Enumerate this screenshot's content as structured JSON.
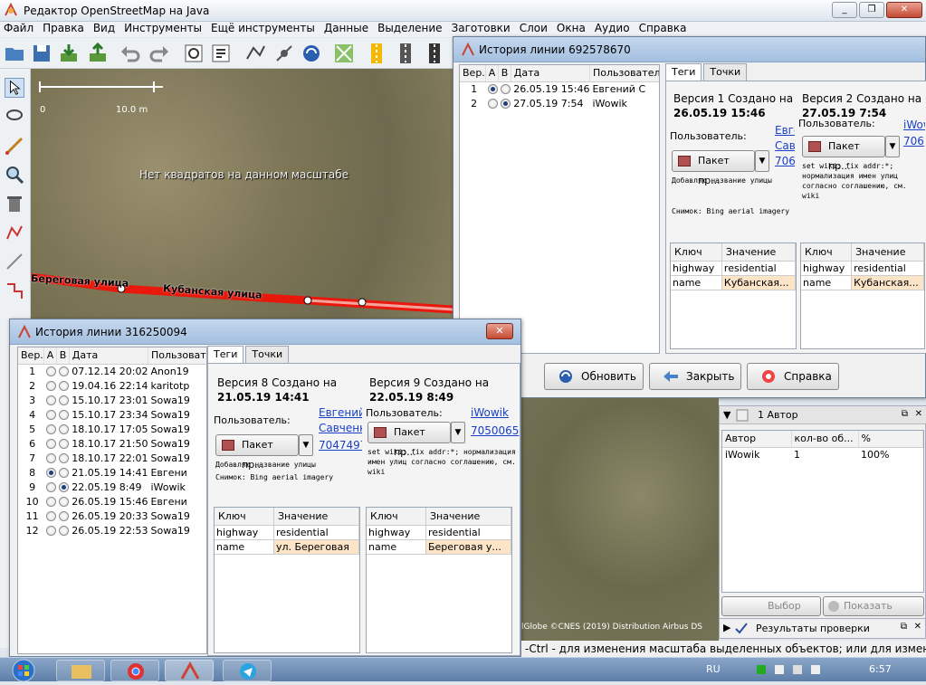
{
  "app": {
    "title": "Редактор OpenStreetMap на Java"
  },
  "menu": [
    "Файл",
    "Правка",
    "Вид",
    "Инструменты",
    "Ещё инструменты",
    "Данные",
    "Выделение",
    "Заготовки",
    "Слои",
    "Окна",
    "Аудио",
    "Справка"
  ],
  "map": {
    "message": "Нет квадратов на данном масштабе",
    "scale_start": "0",
    "scale_end": "10.0 m",
    "road_label_1": "Береговая улица",
    "road_label_2": "Кубанская улица",
    "attribution": "lGlobe ©CNES (2019) Distribution Airbus DS",
    "road_color": "#e8180c"
  },
  "dialog1": {
    "title": "История линии 692578670",
    "columns": [
      "Вер.",
      "A",
      "B",
      "Дата",
      "Пользователь"
    ],
    "rows": [
      {
        "ver": "1",
        "a": true,
        "b": false,
        "date": "26.05.19 15:46",
        "user": "Евгений С"
      },
      {
        "ver": "2",
        "a": false,
        "b": true,
        "date": "27.05.19 7:54",
        "user": "iWowik"
      }
    ],
    "tabs": [
      "Теги",
      "Точки"
    ],
    "left": {
      "version_line": "Версия 1 Создано на",
      "date": "26.05.19 15:46",
      "user_label": "Пользователь:",
      "user_link": "Евгений Савченко",
      "changeset_link": "706",
      "pkt": "Пакет пр...",
      "comment": "Добавляю название улицы",
      "source": "Снимок: Bing aerial imagery"
    },
    "right": {
      "version_line": "Версия 2 Создано на",
      "date": "27.05.19 7:54",
      "user_label": "Пользователь:",
      "user_link": "iWowik",
      "changeset_link": "706",
      "pkt": "Пакет пр...",
      "comment": "set wiki; fix addr:*; нормализация имен улиц согласно соглашению, см. wiki"
    },
    "kv_headers": [
      "Ключ",
      "Значение"
    ],
    "kv_left": [
      [
        "highway",
        "residential"
      ],
      [
        "name",
        "Кубанская..."
      ]
    ],
    "kv_right": [
      [
        "highway",
        "residential"
      ],
      [
        "name",
        "Кубанская..."
      ]
    ],
    "buttons": {
      "refresh": "Обновить",
      "close": "Закрыть",
      "help": "Справка"
    }
  },
  "dialog2": {
    "title": "История линии 316250094",
    "columns": [
      "Вер.",
      "A",
      "B",
      "Дата",
      "Пользователь"
    ],
    "rows": [
      {
        "ver": "1",
        "a": false,
        "b": false,
        "date": "07.12.14 20:02",
        "user": "Anon19"
      },
      {
        "ver": "2",
        "a": false,
        "b": false,
        "date": "19.04.16 22:14",
        "user": "karitotp"
      },
      {
        "ver": "3",
        "a": false,
        "b": false,
        "date": "15.10.17 23:01",
        "user": "Sowa19"
      },
      {
        "ver": "4",
        "a": false,
        "b": false,
        "date": "15.10.17 23:34",
        "user": "Sowa19"
      },
      {
        "ver": "5",
        "a": false,
        "b": false,
        "date": "18.10.17 17:05",
        "user": "Sowa19"
      },
      {
        "ver": "6",
        "a": false,
        "b": false,
        "date": "18.10.17 21:50",
        "user": "Sowa19"
      },
      {
        "ver": "7",
        "a": false,
        "b": false,
        "date": "18.10.17 22:01",
        "user": "Sowa19"
      },
      {
        "ver": "8",
        "a": true,
        "b": false,
        "date": "21.05.19 14:41",
        "user": "Евгени"
      },
      {
        "ver": "9",
        "a": false,
        "b": true,
        "date": "22.05.19 8:49",
        "user": "iWowik"
      },
      {
        "ver": "10",
        "a": false,
        "b": false,
        "date": "26.05.19 15:46",
        "user": "Евгени"
      },
      {
        "ver": "11",
        "a": false,
        "b": false,
        "date": "26.05.19 20:33",
        "user": "Sowa19"
      },
      {
        "ver": "12",
        "a": false,
        "b": false,
        "date": "26.05.19 22:53",
        "user": "Sowa19"
      }
    ],
    "tabs": [
      "Теги",
      "Точки"
    ],
    "left": {
      "version_line": "Версия 8 Создано на",
      "date": "21.05.19 14:41",
      "user_label": "Пользователь:",
      "user_link": "Евгений Савченко",
      "changeset_link": "7047497",
      "pkt": "Пакет пр...",
      "comment": "Добавляю название улицы",
      "source": "Снимок: Bing aerial imagery"
    },
    "right": {
      "version_line": "Версия 9 Создано на",
      "date": "22.05.19 8:49",
      "user_label": "Пользователь:",
      "user_link": "iWowik",
      "changeset_link": "7050065",
      "pkt": "Пакет пр...",
      "comment": "set wiki; fix addr:*; нормализация имен улиц согласно соглашению, см. wiki"
    },
    "kv_headers": [
      "Ключ",
      "Значение"
    ],
    "kv_left": [
      [
        "highway",
        "residential"
      ],
      [
        "name",
        "ул. Береговая"
      ]
    ],
    "kv_right": [
      [
        "highway",
        "residential"
      ],
      [
        "name",
        "Береговая у..."
      ]
    ]
  },
  "authors": {
    "title": "1 Автор",
    "columns": [
      "Автор",
      "кол-во об...",
      "%"
    ],
    "rows": [
      [
        "iWowik",
        "1",
        "100%"
      ]
    ],
    "select_btn": "Выбор",
    "show_info_btn": "Показать инф..."
  },
  "validation": {
    "title": "Результаты проверки"
  },
  "status": {
    "text": "-Ctrl - для изменения масштаба выделенных объектов; или для изменения выделения"
  },
  "tray": {
    "lang": "RU",
    "time": "6:57"
  }
}
